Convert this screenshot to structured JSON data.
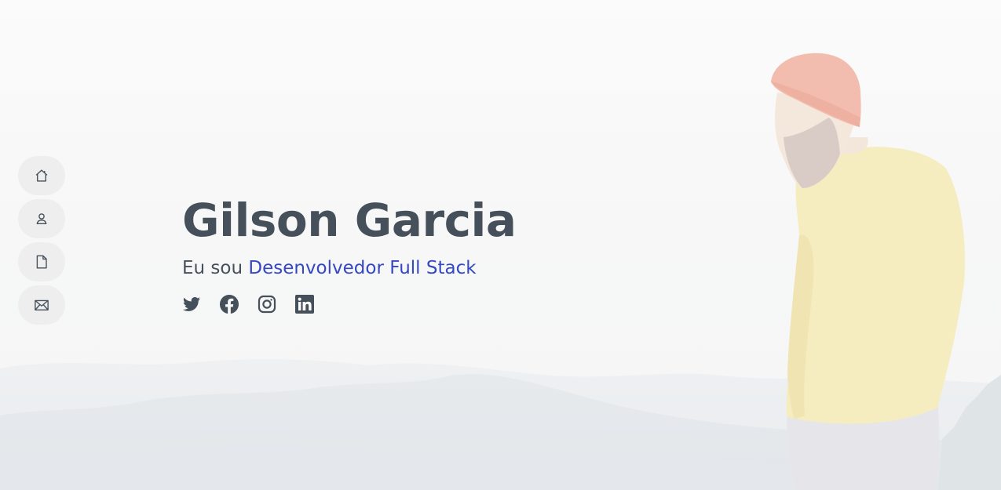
{
  "hero": {
    "name": "Gilson Garcia",
    "intro": "Eu sou",
    "role": "Desenvolvedor Full Stack"
  },
  "nav": {
    "items": [
      {
        "icon": "home-icon"
      },
      {
        "icon": "person-icon"
      },
      {
        "icon": "file-icon"
      },
      {
        "icon": "envelope-icon"
      }
    ]
  },
  "social": {
    "items": [
      {
        "icon": "twitter-icon"
      },
      {
        "icon": "facebook-icon"
      },
      {
        "icon": "instagram-icon"
      },
      {
        "icon": "linkedin-icon"
      }
    ]
  },
  "colors": {
    "heading": "#45505b",
    "accent": "#3547c2",
    "nav_bg": "#eeeeee"
  }
}
